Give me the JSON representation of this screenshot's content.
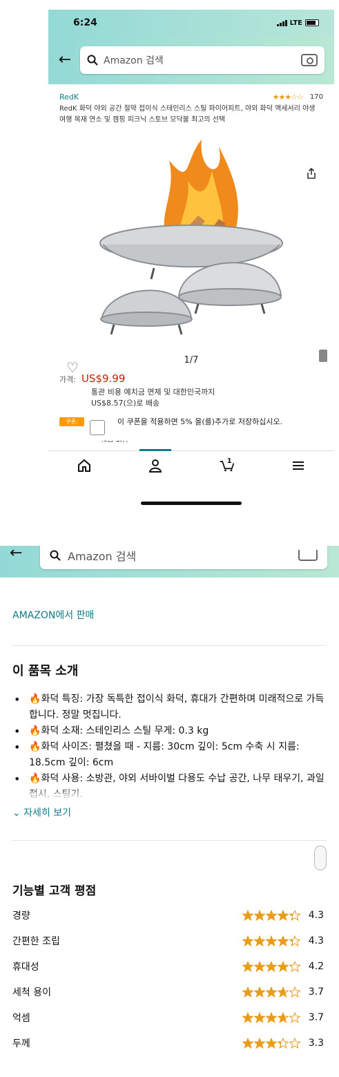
{
  "status": {
    "time": "6:24",
    "network": "LTE"
  },
  "search": {
    "placeholder": "Amazon 검색"
  },
  "product": {
    "brand": "RedK",
    "rating": 3.5,
    "review_count": "170",
    "title": "RedK 화덕 야외 공간 절약 접이식 스테인리스 스틸 파이어피트, 야외 화덕 액세서리 야생 여행 목재 연소 및 캠핑 피크닉 스토브 모닥불 최고의 선택",
    "image_counter": "1/7"
  },
  "price": {
    "label": "가격:",
    "value": "US$9.99",
    "shipping_line1": "통관 비용 예치금 면제 및 대한민국까지",
    "shipping_line2": "US$8.57(으)로 배송"
  },
  "coupon": {
    "badge": "쿠폰:",
    "text": "이 쿠폰을 적용하면 5% 을(를)추가로 저장하십시오.",
    "cut_text": "세부 정보"
  },
  "nav": {
    "cart_count": "1",
    "active": "account"
  },
  "detail": {
    "seller": "AMAZON에서 판매",
    "about_title": "이 품목 소개",
    "flame_icon": "🔥",
    "bullets": [
      "화덕 특징: 가장 독특한 접이식 화덕, 휴대가 간편하며 미래적으로 가득합니다. 정말 멋집니다.",
      "화덕 소재: 스테인리스 스틸 무게: 0.3 kg",
      "화덕 사이즈: 펼쳤을 때 - 지름: 30cm 깊이: 5cm 수축 시 지름: 18.5cm 깊이: 6cm",
      "화덕 사용: 소방관, 야외 서바이벌 다용도 수납 공간, 나무 태우기, 과일 접시, 스팀기."
    ],
    "more": "⌄ 자세히 보기",
    "ratings_title": "기능별 고객 평점",
    "feature_ratings": [
      {
        "label": "경량",
        "value": "4.3",
        "stars": 4.3
      },
      {
        "label": "간편한 조립",
        "value": "4.3",
        "stars": 4.3
      },
      {
        "label": "휴대성",
        "value": "4.2",
        "stars": 4.2
      },
      {
        "label": "세척 용이",
        "value": "3.7",
        "stars": 3.7
      },
      {
        "label": "억셈",
        "value": "3.7",
        "stars": 3.7
      },
      {
        "label": "두께",
        "value": "3.3",
        "stars": 3.3
      }
    ]
  },
  "colors": {
    "header_start": "#93d9d6",
    "header_end": "#b9e8d4",
    "link": "#0f7b86",
    "price": "#b12704",
    "star": "#e89c1a"
  }
}
